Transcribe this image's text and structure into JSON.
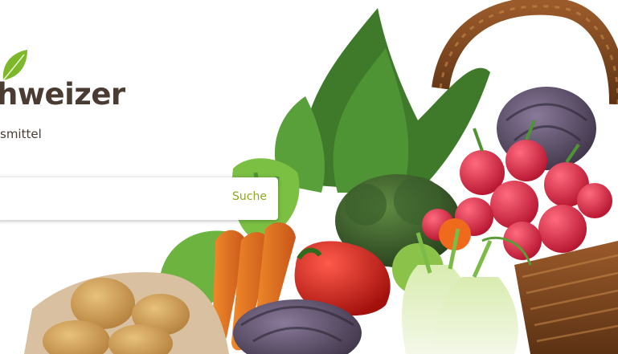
{
  "brand": {
    "name": "hweizer",
    "tagline": "smittel",
    "leaf_icon": "leaf-icon",
    "leaf_color": "#7cb82a"
  },
  "search": {
    "value": "",
    "placeholder": "",
    "button_label": "Suche",
    "button_color": "#8aa820"
  },
  "hero": {
    "image": "basket-of-vegetables"
  }
}
